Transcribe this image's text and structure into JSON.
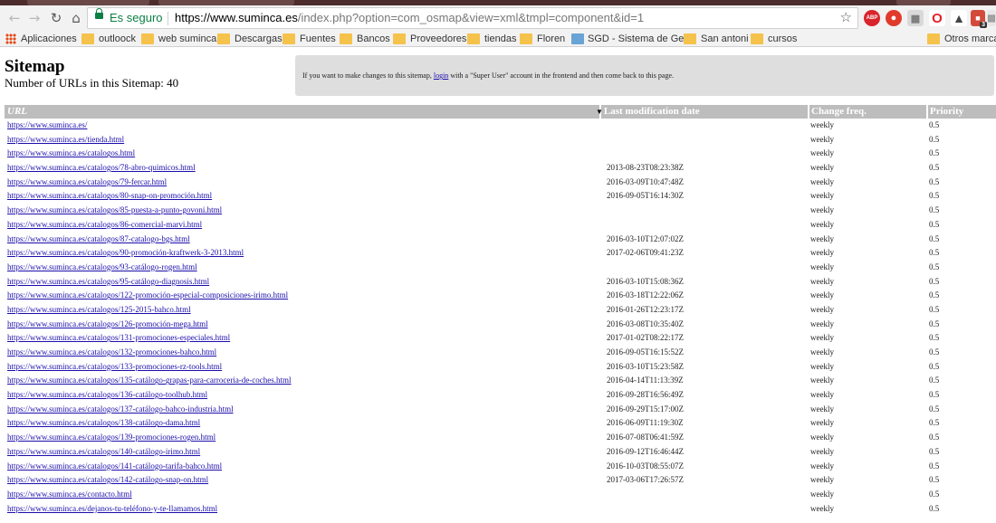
{
  "browser": {
    "secure_label": "Es seguro",
    "url_host": "https://www.suminca.es",
    "url_path": "/index.php?option=com_osmap&view=xml&tmpl=component&id=1",
    "extensions": {
      "abp": "ABP",
      "calendar_count": "3"
    },
    "bookmarks": [
      "Aplicaciones",
      "outloock",
      "web suminca",
      "Descargas",
      "Fuentes",
      "Bancos",
      "Proveedores",
      "tiendas",
      "Floren",
      "SGD - Sistema de Ges",
      "San antoni",
      "cursos",
      "Otros marcad"
    ]
  },
  "page": {
    "title": "Sitemap",
    "count_text": "Number of URLs in this Sitemap: 40",
    "notice_before": "If you want to make changes to this sitemap,",
    "notice_link": "login",
    "notice_after": "with a \"Super User\" account in the frontend and then come back to this page.",
    "columns": {
      "url": "URL",
      "mod": "Last modification date",
      "freq": "Change freq.",
      "prio": "Priority"
    }
  },
  "rows": [
    {
      "url": "https://www.suminca.es/",
      "mod": "",
      "freq": "weekly",
      "prio": "0.5"
    },
    {
      "url": "https://www.suminca.es/tienda.html",
      "mod": "",
      "freq": "weekly",
      "prio": "0.5"
    },
    {
      "url": "https://www.suminca.es/catalogos.html",
      "mod": "",
      "freq": "weekly",
      "prio": "0.5"
    },
    {
      "url": "https://www.suminca.es/catalogos/78-abro-quimicos.html",
      "mod": "2013-08-23T08:23:38Z",
      "freq": "weekly",
      "prio": "0.5"
    },
    {
      "url": "https://www.suminca.es/catalogos/79-fercar.html",
      "mod": "2016-03-09T10:47:48Z",
      "freq": "weekly",
      "prio": "0.5"
    },
    {
      "url": "https://www.suminca.es/catalogos/80-snap-on-promoción.html",
      "mod": "2016-09-05T16:14:30Z",
      "freq": "weekly",
      "prio": "0.5"
    },
    {
      "url": "https://www.suminca.es/catalogos/85-puesta-a-punto-govoni.html",
      "mod": "",
      "freq": "weekly",
      "prio": "0.5"
    },
    {
      "url": "https://www.suminca.es/catalogos/86-comercial-marvi.html",
      "mod": "",
      "freq": "weekly",
      "prio": "0.5"
    },
    {
      "url": "https://www.suminca.es/catalogos/87-catalogo-bgs.html",
      "mod": "2016-03-10T12:07:02Z",
      "freq": "weekly",
      "prio": "0.5"
    },
    {
      "url": "https://www.suminca.es/catalogos/90-promoción-kraftwerk-3-2013.html",
      "mod": "2017-02-06T09:41:23Z",
      "freq": "weekly",
      "prio": "0.5"
    },
    {
      "url": "https://www.suminca.es/catalogos/93-catálogo-rogen.html",
      "mod": "",
      "freq": "weekly",
      "prio": "0.5"
    },
    {
      "url": "https://www.suminca.es/catalogos/95-catálogo-diagnosis.html",
      "mod": "2016-03-10T15:08:36Z",
      "freq": "weekly",
      "prio": "0.5"
    },
    {
      "url": "https://www.suminca.es/catalogos/122-promoción-especial-composiciones-irimo.html",
      "mod": "2016-03-18T12:22:06Z",
      "freq": "weekly",
      "prio": "0.5"
    },
    {
      "url": "https://www.suminca.es/catalogos/125-2015-bahco.html",
      "mod": "2016-01-26T12:23:17Z",
      "freq": "weekly",
      "prio": "0.5"
    },
    {
      "url": "https://www.suminca.es/catalogos/126-promoción-mega.html",
      "mod": "2016-03-08T10:35:40Z",
      "freq": "weekly",
      "prio": "0.5"
    },
    {
      "url": "https://www.suminca.es/catalogos/131-promociones-especiales.html",
      "mod": "2017-01-02T08:22:17Z",
      "freq": "weekly",
      "prio": "0.5"
    },
    {
      "url": "https://www.suminca.es/catalogos/132-promociones-bahco.html",
      "mod": "2016-09-05T16:15:52Z",
      "freq": "weekly",
      "prio": "0.5"
    },
    {
      "url": "https://www.suminca.es/catalogos/133-promociones-rz-tools.html",
      "mod": "2016-03-10T15:23:58Z",
      "freq": "weekly",
      "prio": "0.5"
    },
    {
      "url": "https://www.suminca.es/catalogos/135-catálogo-grapas-para-carroceria-de-coches.html",
      "mod": "2016-04-14T11:13:39Z",
      "freq": "weekly",
      "prio": "0.5"
    },
    {
      "url": "https://www.suminca.es/catalogos/136-catálogo-toolhub.html",
      "mod": "2016-09-28T16:56:49Z",
      "freq": "weekly",
      "prio": "0.5"
    },
    {
      "url": "https://www.suminca.es/catalogos/137-catálogo-bahco-industria.html",
      "mod": "2016-09-29T15:17:00Z",
      "freq": "weekly",
      "prio": "0.5"
    },
    {
      "url": "https://www.suminca.es/catalogos/138-catálogo-dama.html",
      "mod": "2016-06-09T11:19:30Z",
      "freq": "weekly",
      "prio": "0.5"
    },
    {
      "url": "https://www.suminca.es/catalogos/139-promociones-rogen.html",
      "mod": "2016-07-08T06:41:59Z",
      "freq": "weekly",
      "prio": "0.5"
    },
    {
      "url": "https://www.suminca.es/catalogos/140-catálogo-irimo.html",
      "mod": "2016-09-12T16:46:44Z",
      "freq": "weekly",
      "prio": "0.5"
    },
    {
      "url": "https://www.suminca.es/catalogos/141-catálogo-tarifa-bahco.html",
      "mod": "2016-10-03T08:55:07Z",
      "freq": "weekly",
      "prio": "0.5"
    },
    {
      "url": "https://www.suminca.es/catalogos/142-catálogo-snap-on.html",
      "mod": "2017-03-06T17:26:57Z",
      "freq": "weekly",
      "prio": "0.5"
    },
    {
      "url": "https://www.suminca.es/contacto.html",
      "mod": "",
      "freq": "weekly",
      "prio": "0.5"
    },
    {
      "url": "https://www.suminca.es/dejanos-tu-teléfono-y-te-llamamos.html",
      "mod": "",
      "freq": "weekly",
      "prio": "0.5"
    }
  ]
}
